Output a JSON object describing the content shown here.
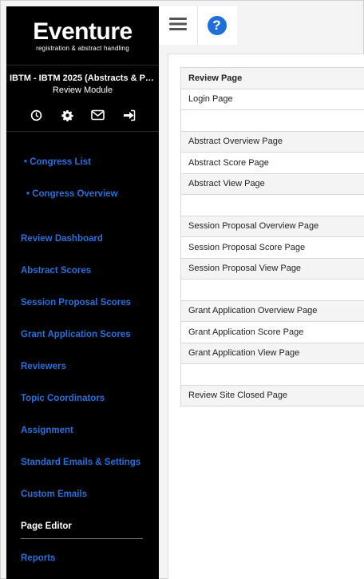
{
  "brand": {
    "name": "Eventure",
    "tagline": "registration & abstract handling"
  },
  "sidebar": {
    "event_title": "IBTM - IBTM 2025 (Abstracts & Par...",
    "module": "Review Module",
    "icons": [
      "clock-icon",
      "gear-icon",
      "envelope-icon",
      "sign-out-icon"
    ],
    "items": [
      {
        "label": "• Congress List",
        "active": false
      },
      {
        "label": "• Congress Overview",
        "active": false
      },
      {
        "label": "Review Dashboard",
        "active": false
      },
      {
        "label": "Abstract Scores",
        "active": false
      },
      {
        "label": "Session Proposal Scores",
        "active": false
      },
      {
        "label": "Grant Application Scores",
        "active": false
      },
      {
        "label": "Reviewers",
        "active": false
      },
      {
        "label": "Topic Coordinators",
        "active": false
      },
      {
        "label": "Assignment",
        "active": false
      },
      {
        "label": "Standard Emails & Settings",
        "active": false
      },
      {
        "label": "Custom Emails",
        "active": false
      },
      {
        "label": "Page Editor",
        "active": true
      },
      {
        "label": "Reports",
        "active": false
      }
    ]
  },
  "toolbar": {
    "menu_icon": "hamburger-icon",
    "help_label": "?"
  },
  "page_list": {
    "header": "Review Page",
    "rows": [
      "Login Page",
      "",
      "Abstract Overview Page",
      "Abstract Score Page",
      "Abstract View Page",
      "",
      "Session Proposal Overview Page",
      "Session Proposal Score Page",
      "Session Proposal View Page",
      "",
      "Grant Application Overview Page",
      "Grant Application Score Page",
      "Grant Application View Page",
      "",
      "Review Site Closed Page"
    ]
  },
  "colors": {
    "sidebar_bg": "#000000",
    "link": "#2a6fdb",
    "help": "#1f6fd6"
  }
}
